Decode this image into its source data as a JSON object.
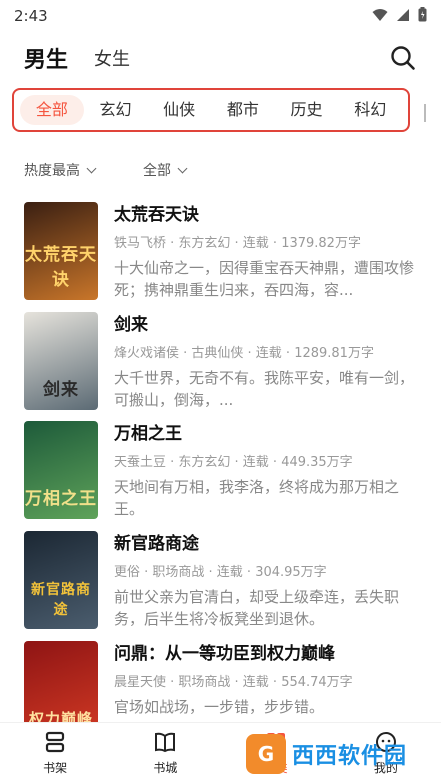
{
  "status": {
    "time": "2:43"
  },
  "gender_tabs": [
    {
      "label": "男生"
    },
    {
      "label": "女生"
    }
  ],
  "categories": [
    "全部",
    "玄幻",
    "仙侠",
    "都市",
    "历史",
    "科幻"
  ],
  "filters": {
    "sort": "热度最高",
    "scope": "全部"
  },
  "books": [
    {
      "title": "太荒吞天诀",
      "meta": "铁马飞桥 · 东方玄幻 · 连载 · 1379.82万字",
      "desc": "十大仙帝之一，因得重宝吞天神鼎，遭围攻惨死；携神鼎重生归来，吞四海，容...",
      "cover_text": "太荒吞天诀",
      "cover_colors": [
        "#3a1f12",
        "#c9762a"
      ]
    },
    {
      "title": "剑来",
      "meta": "烽火戏诸侯 · 古典仙侠 · 连载 · 1289.81万字",
      "desc": "大千世界，无奇不有。我陈平安，唯有一剑，可搬山，倒海，...",
      "cover_text": "剑来",
      "cover_colors": [
        "#d9d6cf",
        "#5b6a74"
      ]
    },
    {
      "title": "万相之王",
      "meta": "天蚕土豆 · 东方玄幻 · 连载 · 449.35万字",
      "desc": "天地间有万相，我李洛，终将成为那万相之王。",
      "cover_text": "万相之王",
      "cover_colors": [
        "#1d5a3a",
        "#5fa35a"
      ]
    },
    {
      "title": "新官路商途",
      "meta": "更俗 · 职场商战 · 连载 · 304.95万字",
      "desc": "前世父亲为官清白，却受上级牵连，丢失职务，后半生将冷板凳坐到退休。",
      "cover_text": "新官路商途",
      "cover_colors": [
        "#1b2733",
        "#4b5d6e"
      ]
    },
    {
      "title": "问鼎：从一等功臣到权力巅峰",
      "meta": "晨星天使 · 职场商战 · 连载 · 554.74万字",
      "desc": "官场如战场，一步错，步步错。",
      "cover_text": "权力巅峰",
      "cover_colors": [
        "#8e1414",
        "#d23a24"
      ]
    }
  ],
  "tabbar": [
    {
      "label": "书架",
      "icon": "bookshelf-icon"
    },
    {
      "label": "书城",
      "icon": "book-store-icon"
    },
    {
      "label": "分类",
      "icon": "category-icon"
    },
    {
      "label": "我的",
      "icon": "profile-icon"
    }
  ],
  "watermark": {
    "box": "G",
    "text": "西西软件园"
  },
  "accent": "#f5553f",
  "highlight_border": "#e0443a"
}
